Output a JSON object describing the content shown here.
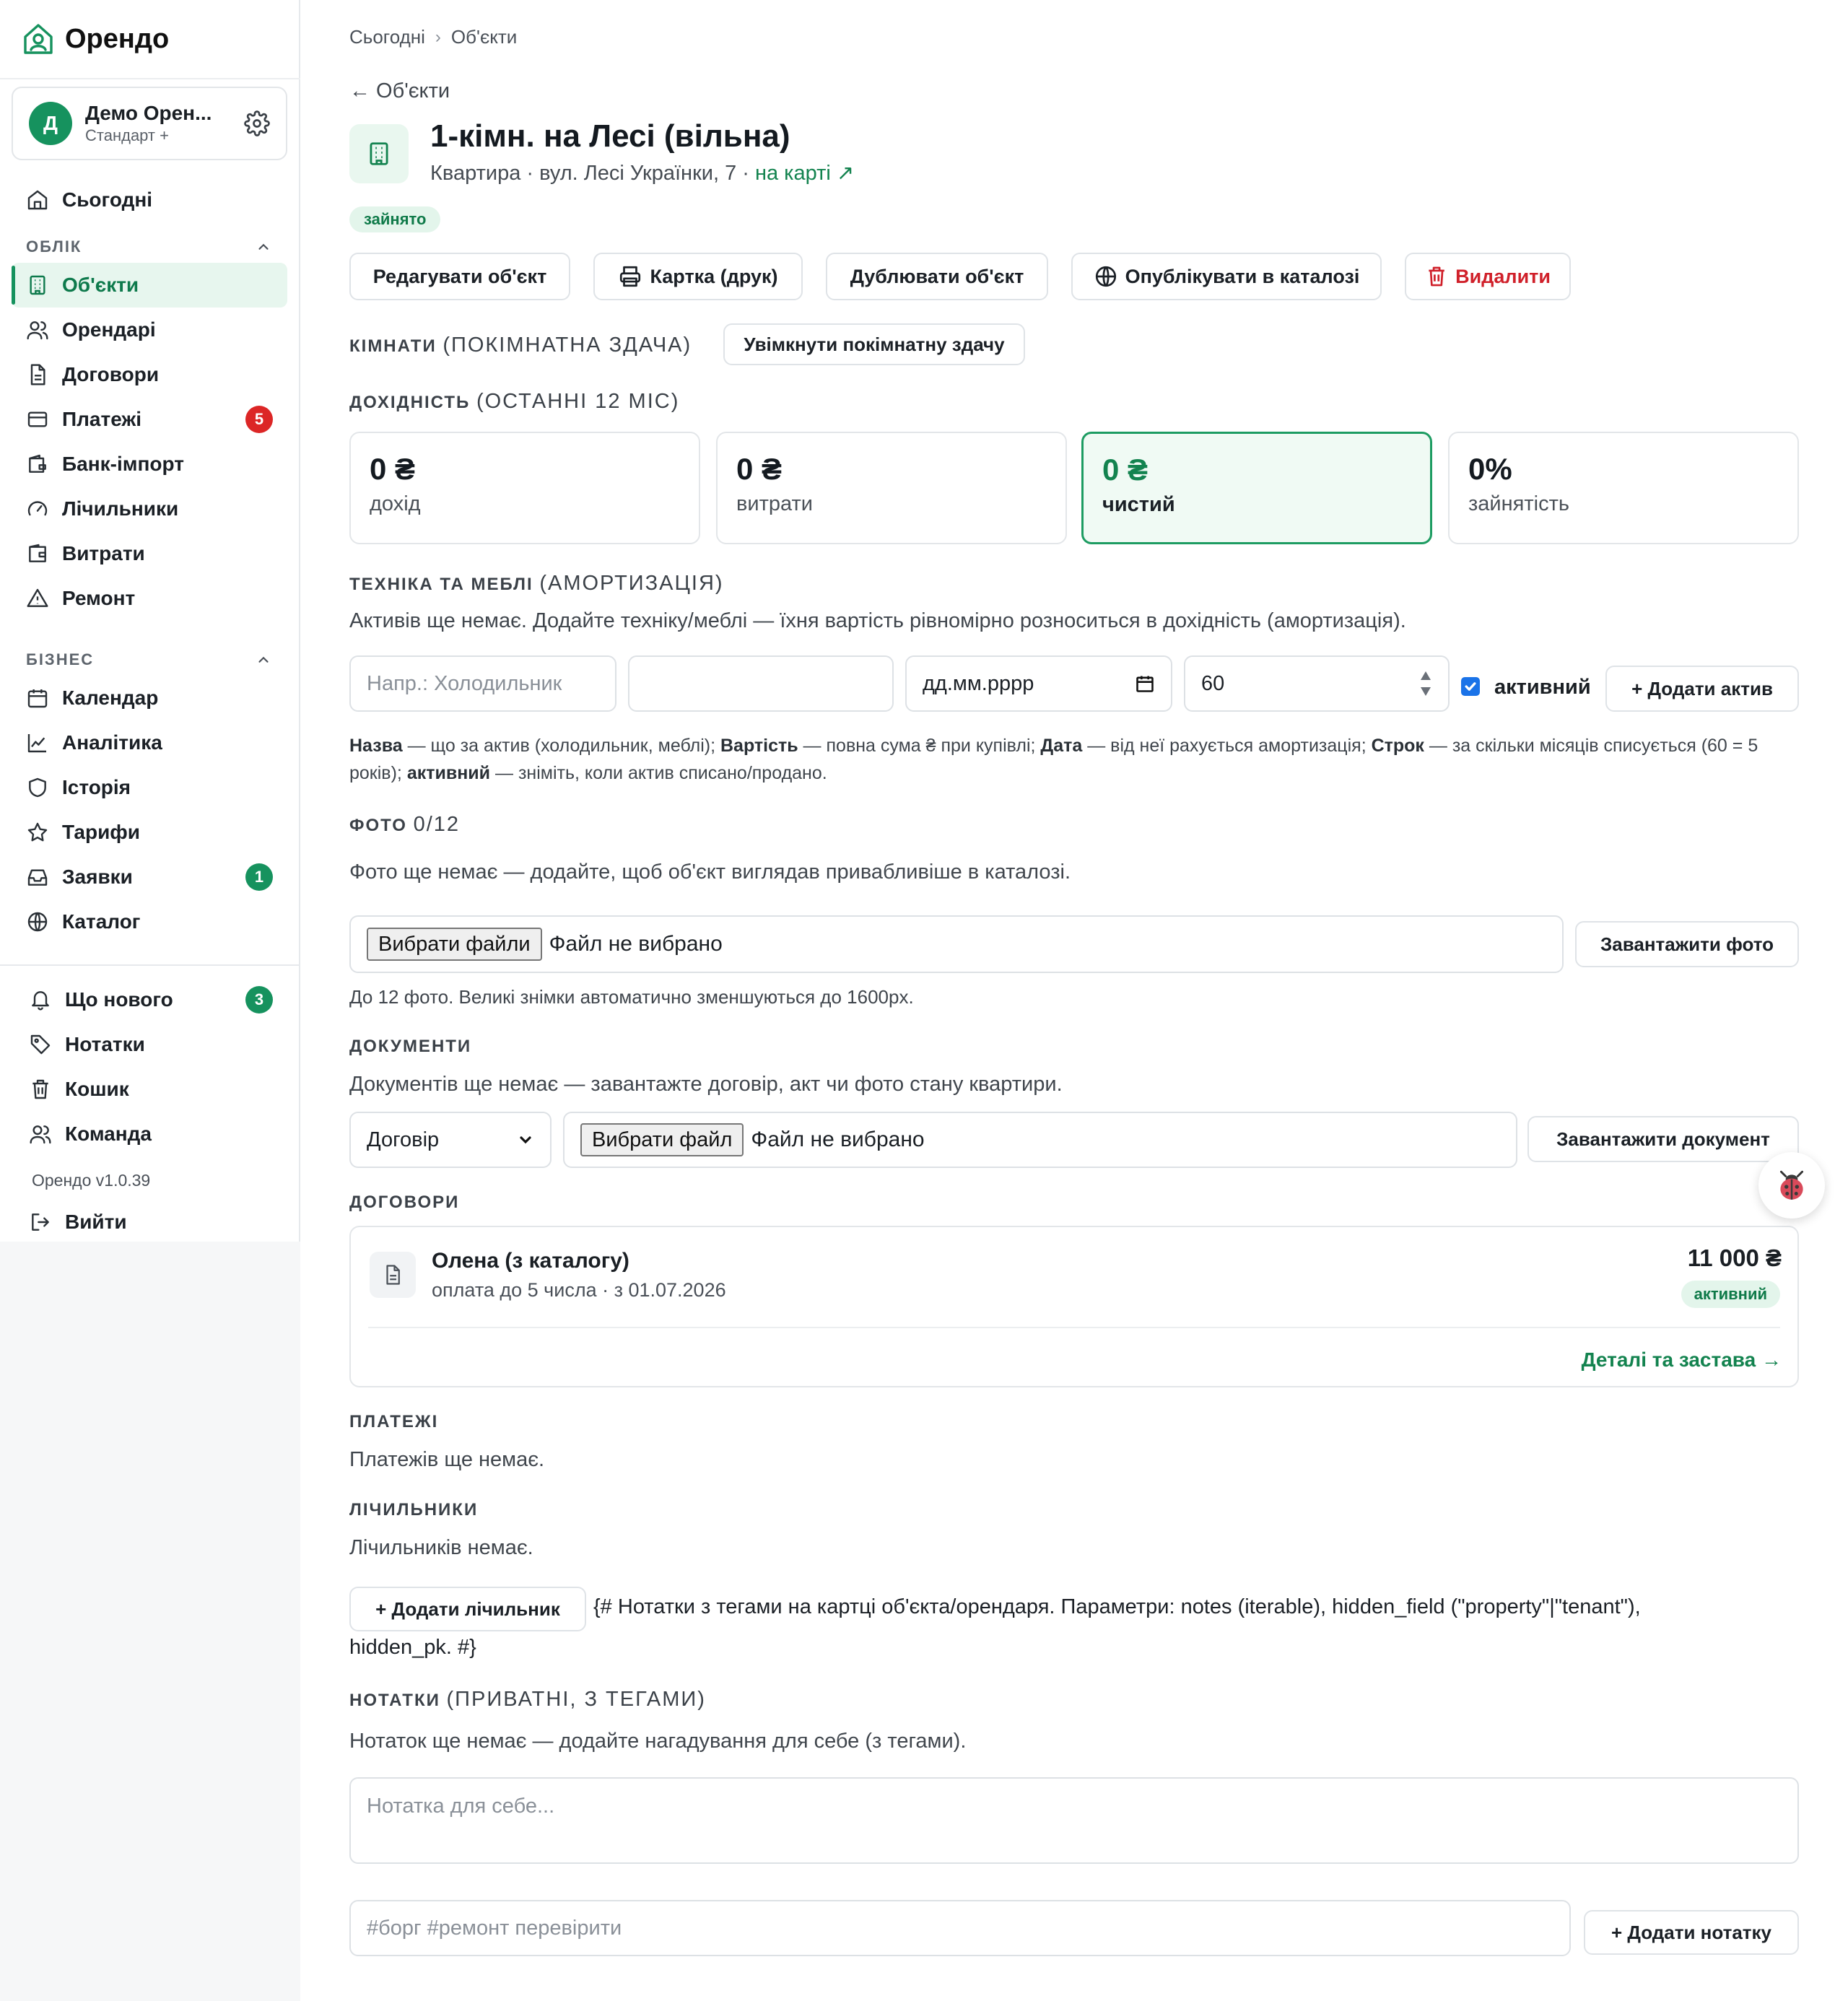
{
  "brand": {
    "name": "Орендо"
  },
  "account": {
    "initial": "Д",
    "name": "Демо Орен...",
    "plan": "Стандарт +"
  },
  "nav": {
    "today": "Сьогодні",
    "section_accounting": "ОБЛІК",
    "properties": "Об'єкти",
    "tenants": "Орендарі",
    "contracts": "Договори",
    "payments": "Платежі",
    "payments_badge": "5",
    "bank_import": "Банк-імпорт",
    "meters": "Лічильники",
    "expenses": "Витрати",
    "repair": "Ремонт",
    "section_business": "БІЗНЕС",
    "calendar": "Календар",
    "analytics": "Аналітика",
    "history": "Історія",
    "tariffs": "Тарифи",
    "requests": "Заявки",
    "requests_badge": "1",
    "catalog": "Каталог",
    "whats_new": "Що нового",
    "whats_new_badge": "3",
    "notes": "Нотатки",
    "trash": "Кошик",
    "team": "Команда",
    "version": "Орендо v1.0.39",
    "logout": "Вийти"
  },
  "breadcrumb": {
    "home": "Сьогодні",
    "sep": "›",
    "current": "Об'єкти"
  },
  "back_link": "← Об'єкти",
  "property": {
    "title": "1-кімн. на Лесі (вільна)",
    "subtitle": "Квартира · вул. Лесі Українки, 7 ·",
    "map_link": "на карті ↗",
    "status": "зайнято"
  },
  "actions": {
    "edit": "Редагувати об'єкт",
    "print": "Картка (друк)",
    "duplicate": "Дублювати об'єкт",
    "publish": "Опублікувати в каталозі",
    "delete": "Видалити"
  },
  "rooms": {
    "label": "КІМНАТИ",
    "label_thin": "(ПОКІМНАТНА ЗДАЧА)",
    "toggle": "Увімкнути покімнатну здачу"
  },
  "profit": {
    "label": "ДОХІДНІСТЬ",
    "label_thin": "(ОСТАННІ 12 МІС)",
    "income_value": "0 ₴",
    "income_label": "дохід",
    "expenses_value": "0 ₴",
    "expenses_label": "витрати",
    "net_value": "0 ₴",
    "net_label": "чистий",
    "occupancy_value": "0%",
    "occupancy_label": "зайнятість"
  },
  "assets": {
    "label": "ТЕХНІКА ТА МЕБЛІ",
    "label_thin": "(АМОРТИЗАЦІЯ)",
    "empty": "Активів ще немає. Додайте техніку/меблі — їхня вартість рівномірно розноситься в дохідність (амортизація).",
    "name_placeholder": "Напр.: Холодильник",
    "cost_value": "",
    "date_placeholder": "дд.мм.рррр",
    "term_value": "60",
    "active_label": "активний",
    "add_button": "+ Додати актив",
    "hint_name": "Назва",
    "hint_name_desc": " — що за актив (холодильник, меблі); ",
    "hint_cost": "Вартість",
    "hint_cost_desc": " — повна сума ₴ при купівлі; ",
    "hint_date": "Дата",
    "hint_date_desc": " — від неї рахується амортизація; ",
    "hint_term": "Строк",
    "hint_term_desc": " — за скільки місяців списується (60 = 5 років); ",
    "hint_active": "активний",
    "hint_active_desc": " — зніміть, коли актив списано/продано."
  },
  "photos": {
    "label": "ФОТО",
    "count": "0/12",
    "empty": "Фото ще немає — додайте, щоб об'єкт виглядав привабливіше в каталозі.",
    "choose_files": "Вибрати файли",
    "no_file": "Файл не вибрано",
    "upload": "Завантажити фото",
    "hint": "До 12 фото. Великі знімки автоматично зменшуються до 1600px."
  },
  "documents": {
    "label": "ДОКУМЕНТИ",
    "empty": "Документів ще немає — завантажте договір, акт чи фото стану квартири.",
    "type_selected": "Договір",
    "choose_file": "Вибрати файл",
    "no_file": "Файл не вибрано",
    "upload": "Завантажити документ"
  },
  "contracts": {
    "label": "ДОГОВОРИ",
    "items": [
      {
        "tenant": "Олена (з каталогу)",
        "terms": "оплата до 5 числа · з 01.07.2026",
        "amount": "11 000 ₴",
        "status": "активний",
        "details": "Деталі та застава →"
      }
    ]
  },
  "payments": {
    "label": "ПЛАТЕЖІ",
    "empty": "Платежів ще немає."
  },
  "meters": {
    "label": "ЛІЧИЛЬНИКИ",
    "empty": "Лічильників немає.",
    "add_button": "+ Додати лічильник",
    "template_comment_line1": "{# Нотатки з тегами на картці об'єкта/орендаря. Параметри: notes (iterable), hidden_field (\"property\"|\"tenant\"),",
    "template_comment_line2": "hidden_pk. #}"
  },
  "notes": {
    "label": "НОТАТКИ",
    "label_thin": "(ПРИВАТНІ, З ТЕГАМИ)",
    "empty": "Нотаток ще немає — додайте нагадування для себе (з тегами).",
    "text_placeholder": "Нотатка для себе...",
    "tags_placeholder": "#борг #ремонт перевірити",
    "add_button": "+ Додати нотатку"
  },
  "colors": {
    "accent": "#16925e",
    "accent_text": "#13834f",
    "danger": "#d0202a",
    "badge_red": "#dc2626"
  }
}
